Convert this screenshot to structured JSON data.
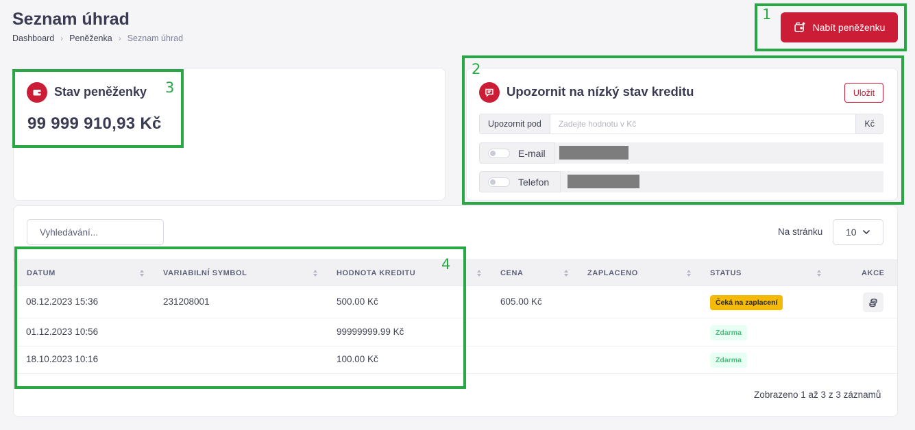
{
  "header": {
    "title": "Seznam úhrad",
    "breadcrumb": [
      "Dashboard",
      "Peněženka",
      "Seznam úhrad"
    ],
    "breadcrumb_sep": "›",
    "charge_button": "Nabít peněženku"
  },
  "annotations": [
    "1",
    "2",
    "3",
    "4"
  ],
  "wallet": {
    "title": "Stav peněženky",
    "amount": "99 999 910,93 Kč",
    "icon": "wallet-icon"
  },
  "alert": {
    "title": "Upozornit na nízký stav kreditu",
    "save_label": "Uložit",
    "threshold_prefix": "Upozornit pod",
    "threshold_placeholder": "Zadejte hodnotu v Kč",
    "threshold_suffix": "Kč",
    "email_label": "E-mail",
    "phone_label": "Telefon",
    "email_enabled": false,
    "phone_enabled": false
  },
  "table": {
    "search_placeholder": "Vyhledávání...",
    "per_page_label": "Na stránku",
    "per_page_value": "10",
    "columns": [
      "DATUM",
      "VARIABILNÍ SYMBOL",
      "HODNOTA KREDITU",
      "CENA",
      "ZAPLACENO",
      "STATUS",
      "AKCE"
    ],
    "rows": [
      {
        "date": "08.12.2023 15:36",
        "vs": "231208001",
        "credit": "500.00 Kč",
        "price": "605.00 Kč",
        "paid": "",
        "status": "Čeká na zaplacení",
        "status_type": "warning",
        "has_action": true
      },
      {
        "date": "01.12.2023 10:56",
        "vs": "",
        "credit": "99999999.99 Kč",
        "price": "",
        "paid": "",
        "status": "Zdarma",
        "status_type": "success",
        "has_action": false
      },
      {
        "date": "18.10.2023 10:16",
        "vs": "",
        "credit": "100.00 Kč",
        "price": "",
        "paid": "",
        "status": "Zdarma",
        "status_type": "success",
        "has_action": false
      }
    ],
    "summary": "Zobrazeno 1 až 3 z 3 záznamů"
  },
  "colors": {
    "accent": "#cb1e36",
    "annotation": "#27a844",
    "warning_badge": "#f5b907",
    "success_badge_bg": "#e8fff3",
    "success_badge_text": "#47be7d"
  }
}
